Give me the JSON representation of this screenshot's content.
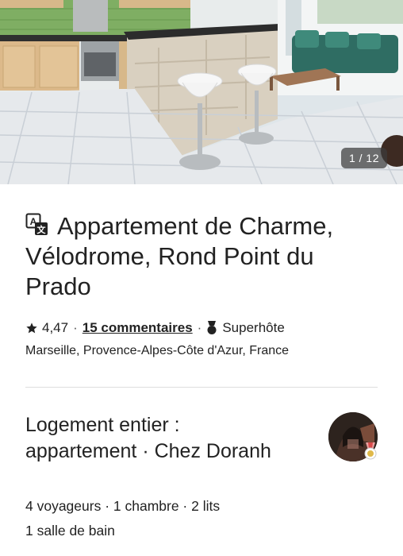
{
  "gallery": {
    "counter": "1 / 12",
    "photo_description_icon": "kitchen-living-room-photo"
  },
  "listing": {
    "title": "Appartement de Charme, Vélodrome, Rond Point du Prado",
    "rating": "4,47",
    "reviews_link": "15 commentaires",
    "separator": "·",
    "superhost_label": "Superhôte",
    "location": "Marseille, Provence-Alpes-Côte d'Azur, France"
  },
  "host_section": {
    "title": "Logement entier : appartement · Chez Doranh",
    "details_line1": "4 voyageurs · 1 chambre · 2 lits",
    "details_line2": "1 salle de bain"
  },
  "icons": {
    "translate": "translate-icon",
    "star": "star-icon",
    "superhost": "medal-icon",
    "avatar_badge": "superhost-badge-icon"
  },
  "colors": {
    "text": "#222222",
    "divider": "#dddddd",
    "counter_bg": "#3c3c3c"
  }
}
